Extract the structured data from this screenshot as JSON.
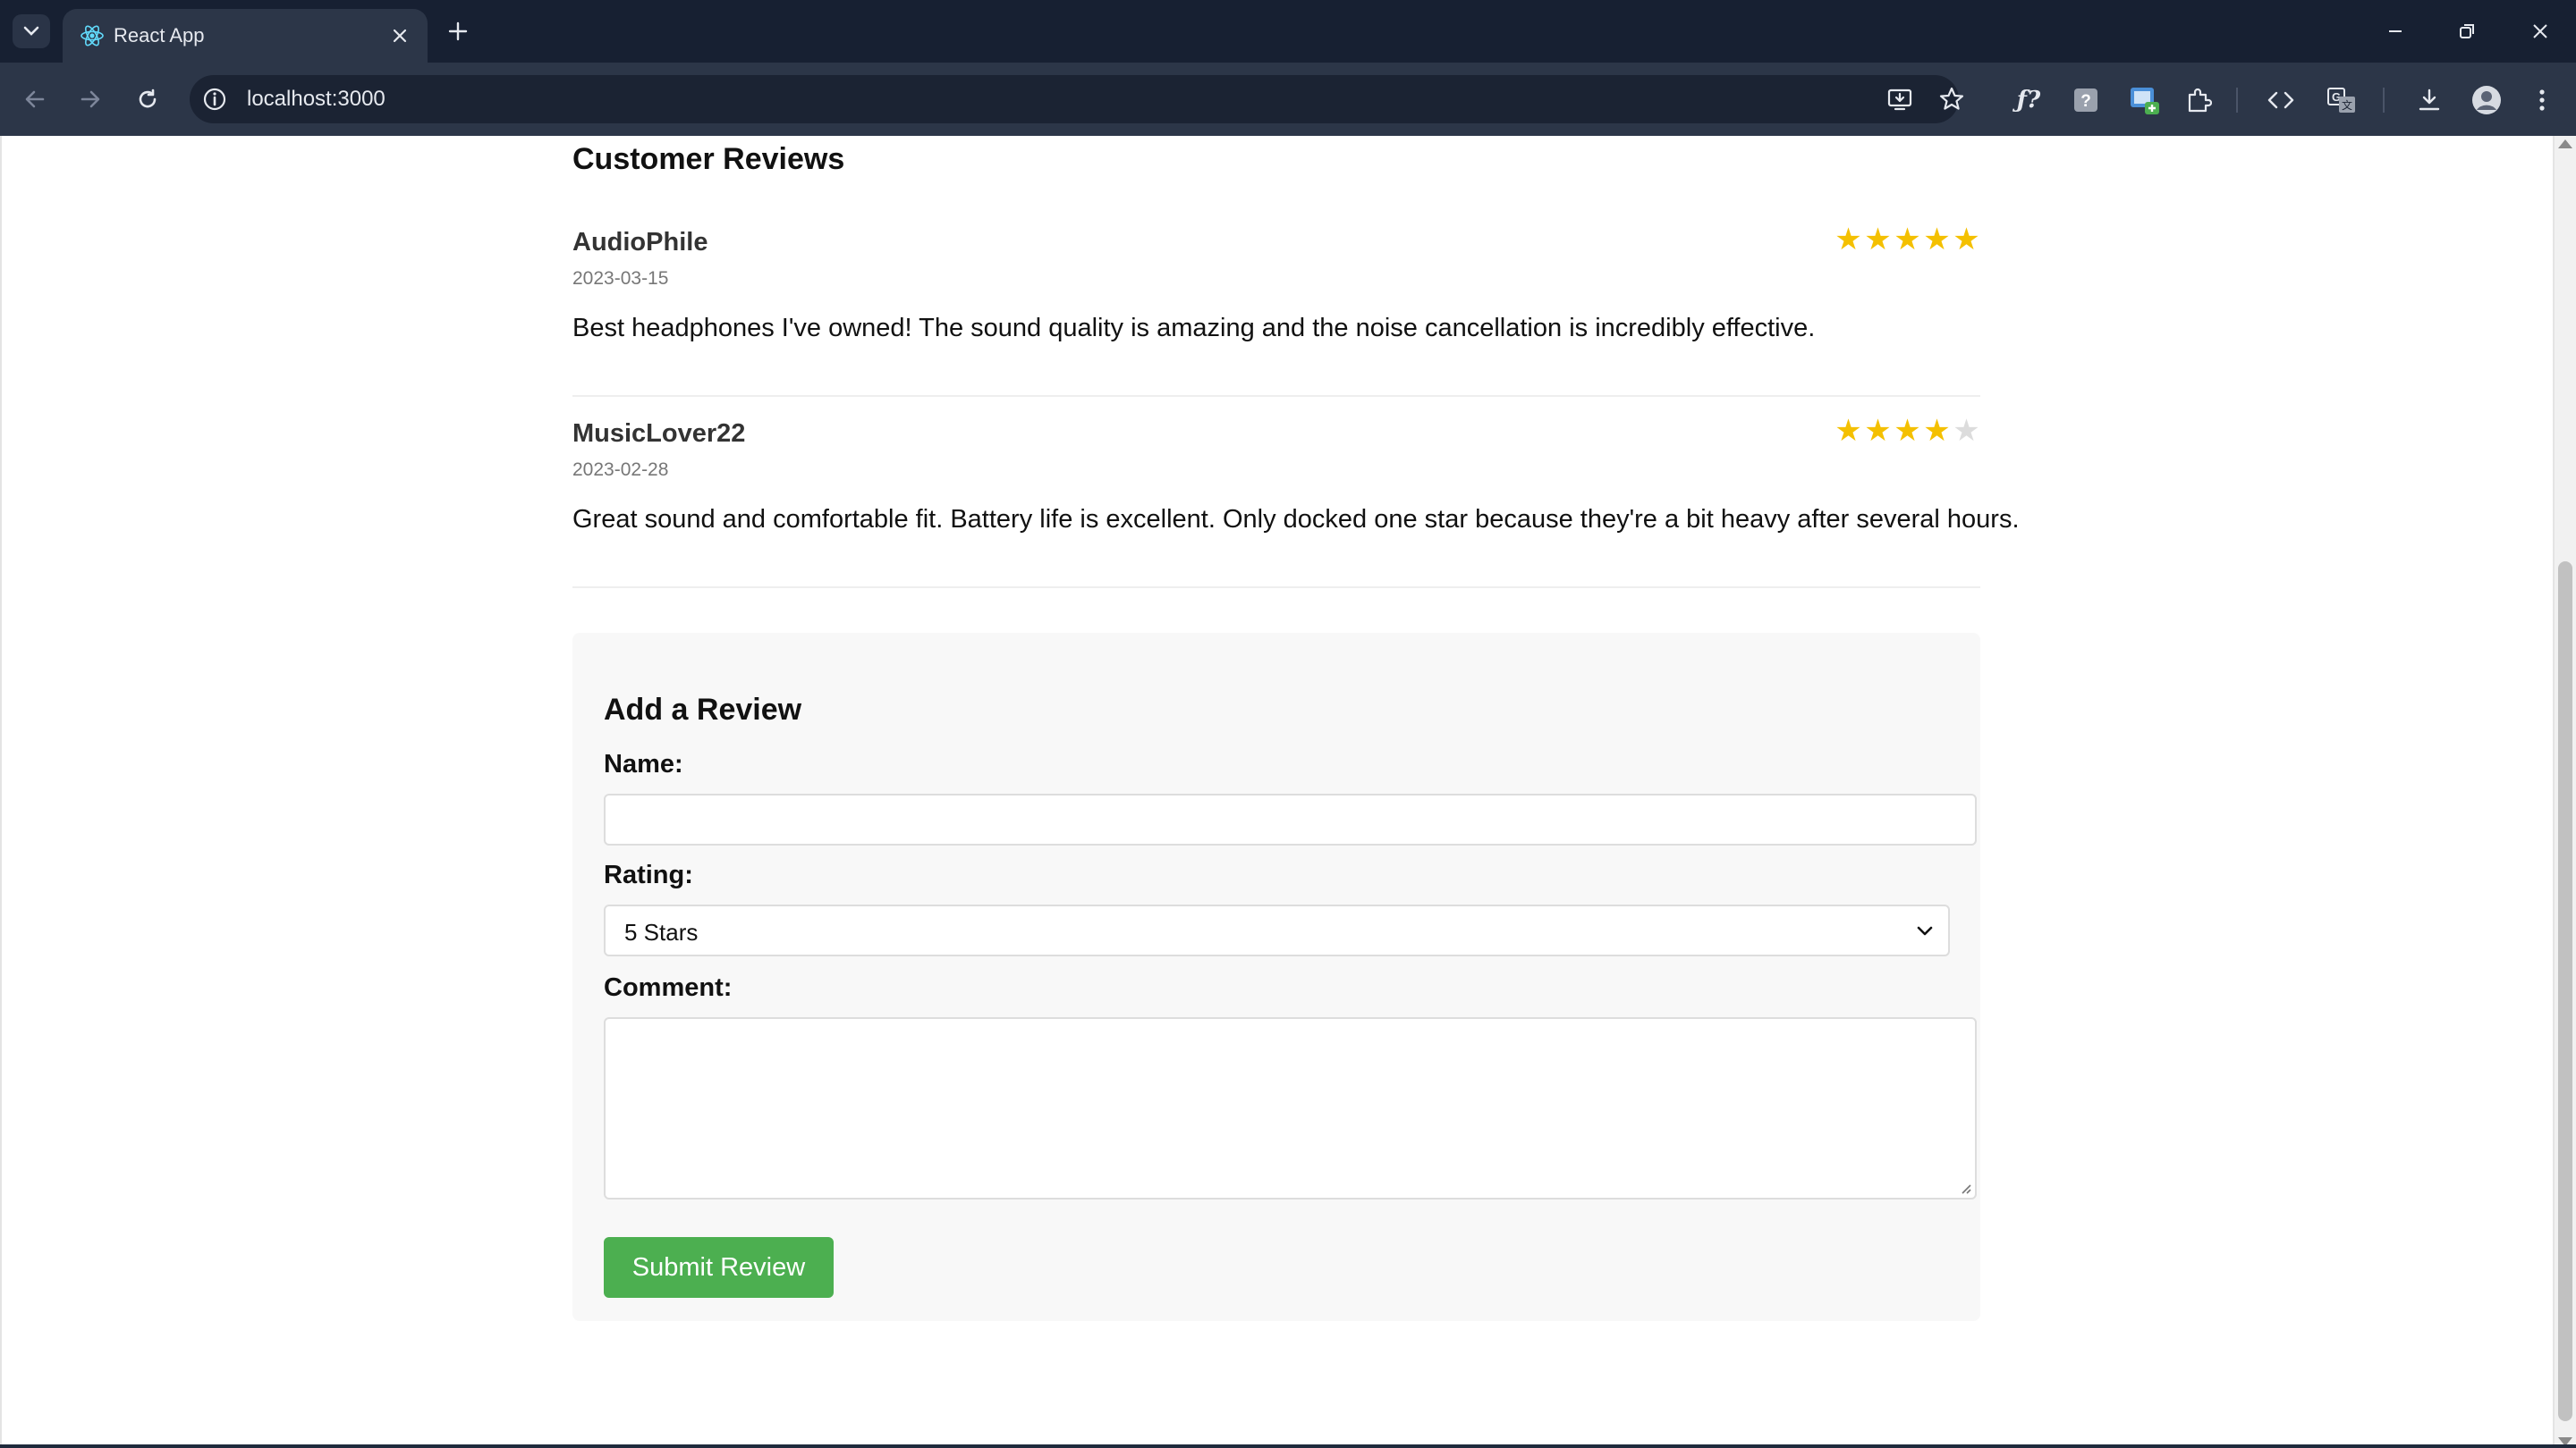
{
  "browser": {
    "tab_title": "React App",
    "url": "localhost:3000",
    "colors": {
      "tabstrip": "#172032",
      "toolbar": "#2c3648"
    },
    "toolbar_icons": [
      "install-app-icon",
      "bookmark-star-icon",
      "fx-extension-icon",
      "help-extension-icon",
      "image-extension-icon",
      "extensions-puzzle-icon",
      "devtools-code-icon",
      "translate-icon",
      "downloads-icon",
      "profile-avatar-icon",
      "menu-kebab-icon"
    ]
  },
  "reviews_section": {
    "title": "Customer Reviews",
    "reviews": [
      {
        "author": "AudioPhile",
        "date": "2023-03-15",
        "rating": 5,
        "max_rating": 5,
        "text": "Best headphones I've owned! The sound quality is amazing and the noise cancellation is incredibly effective."
      },
      {
        "author": "MusicLover22",
        "date": "2023-02-28",
        "rating": 4,
        "max_rating": 5,
        "text": "Great sound and comfortable fit. Battery life is excellent. Only docked one star because they're a bit heavy after several hours."
      }
    ],
    "colors": {
      "star_on": "#f4c000",
      "star_off": "#dcdcdc"
    }
  },
  "review_form": {
    "title": "Add a Review",
    "name_label": "Name:",
    "name_value": "",
    "rating_label": "Rating:",
    "rating_value": "5 Stars",
    "comment_label": "Comment:",
    "comment_value": "",
    "submit_label": "Submit Review",
    "colors": {
      "submit_bg": "#4caf50",
      "card_bg": "#f8f8f8"
    }
  }
}
